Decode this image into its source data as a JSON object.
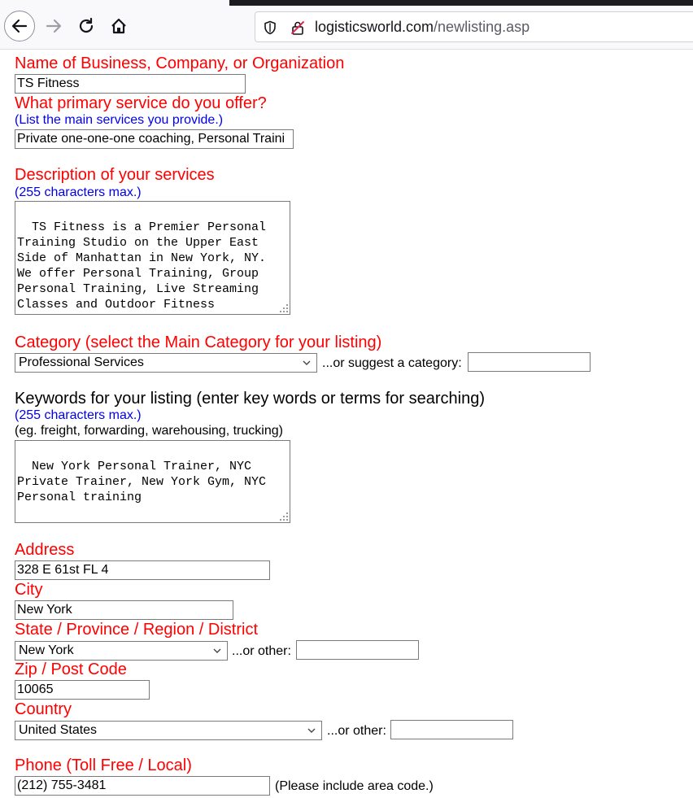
{
  "browser": {
    "url_domain": "logisticsworld.com",
    "url_path": "/newlisting.asp"
  },
  "form": {
    "business_name": {
      "label": "Name of Business, Company, or Organization",
      "value": "TS Fitness"
    },
    "primary_service": {
      "label": "What primary service do you offer?",
      "hint": "(List the main services you provide.)",
      "value": "Private one-one-one coaching, Personal Traini"
    },
    "description": {
      "label": "Description of your services",
      "hint": "(255 characters max.)",
      "value": "TS Fitness is a Premier Personal\nTraining Studio on the Upper East\nSide of Manhattan in New York, NY.\nWe offer Personal Training, Group\nPersonal Training, Live Streaming\nClasses and Outdoor Fitness\nClasses."
    },
    "category": {
      "label": "Category (select the Main Category for your listing)",
      "selected": "Professional Services",
      "suggest_label": "...or suggest a category:",
      "suggest_value": ""
    },
    "keywords": {
      "label": "Keywords for your listing (enter key words or terms for searching)",
      "hint": "(255 characters max.)",
      "example": "(eg. freight, forwarding, warehousing, trucking)",
      "value": "New York Personal Trainer, NYC\nPrivate Trainer, New York Gym, NYC\nPersonal training"
    },
    "address": {
      "label": "Address",
      "value": "328 E 61st FL 4"
    },
    "city": {
      "label": "City",
      "value": "New York"
    },
    "state": {
      "label": "State / Province / Region / District",
      "selected": "New York",
      "other_label": "...or other:",
      "other_value": ""
    },
    "zip": {
      "label": "Zip / Post Code",
      "value": "10065"
    },
    "country": {
      "label": "Country",
      "selected": "United States",
      "other_label": "...or other:",
      "other_value": ""
    },
    "phone": {
      "label": "Phone (Toll Free / Local)",
      "value": "(212) 755-3481",
      "note": "(Please include area code.)"
    }
  },
  "colors": {
    "label": "#ff0000",
    "hint": "#0000ee"
  },
  "icons": [
    "back-arrow-icon",
    "forward-arrow-icon",
    "reload-icon",
    "home-icon",
    "shield-icon",
    "insecure-lock-icon",
    "chevron-down-icon",
    "resize-grip-icon"
  ]
}
